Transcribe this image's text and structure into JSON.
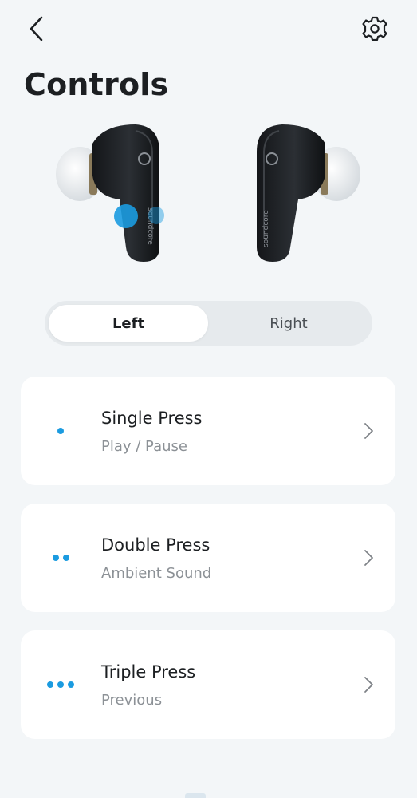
{
  "header": {
    "back_icon": "chevron-left-icon",
    "settings_icon": "gear-icon"
  },
  "page": {
    "title": "Controls"
  },
  "earbuds": {
    "logo_text": "soundcore",
    "body_color": "#1e2125",
    "tip_color": "#dfe3e6",
    "highlight_color": "#1b9be0"
  },
  "side_selector": {
    "options": [
      "Left",
      "Right"
    ],
    "selected": "Left"
  },
  "controls": [
    {
      "title": "Single Press",
      "action": "Play / Pause",
      "dots": 1
    },
    {
      "title": "Double Press",
      "action": "Ambient Sound",
      "dots": 2
    },
    {
      "title": "Triple Press",
      "action": "Previous",
      "dots": 3
    }
  ],
  "colors": {
    "background": "#f3f6f8",
    "card": "#ffffff",
    "accent": "#1b9be0",
    "subtext": "#8c9196"
  }
}
